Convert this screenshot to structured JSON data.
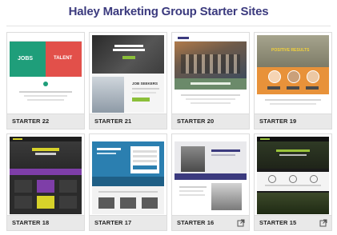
{
  "page": {
    "title": "Haley Marketing Group Starter Sites"
  },
  "cards": [
    {
      "label": "STARTER 22",
      "thumb_text": [
        "JOBS",
        "TALENT"
      ],
      "external_link": false
    },
    {
      "label": "STARTER 21",
      "thumb_text": [
        "JOB SEEKERS"
      ],
      "external_link": false
    },
    {
      "label": "STARTER 20",
      "thumb_text": [],
      "external_link": false
    },
    {
      "label": "STARTER 19",
      "thumb_text": [
        "POSITIVE RESULTS"
      ],
      "external_link": false
    },
    {
      "label": "STARTER 18",
      "thumb_text": [],
      "external_link": false
    },
    {
      "label": "STARTER 17",
      "thumb_text": [],
      "external_link": false
    },
    {
      "label": "STARTER 16",
      "thumb_text": [],
      "external_link": true
    },
    {
      "label": "STARTER 15",
      "thumb_text": [],
      "external_link": true
    }
  ],
  "colors": {
    "title": "#3b3a7e",
    "s22_green": "#1f9e7a",
    "s22_red": "#e2504a",
    "s19_orange": "#e8923a",
    "s17_blue": "#2b7fb0",
    "s18_yellow": "#d7d22a",
    "s18_purple": "#7e3ea8"
  },
  "icons": {
    "external_link": "external-link-icon"
  }
}
